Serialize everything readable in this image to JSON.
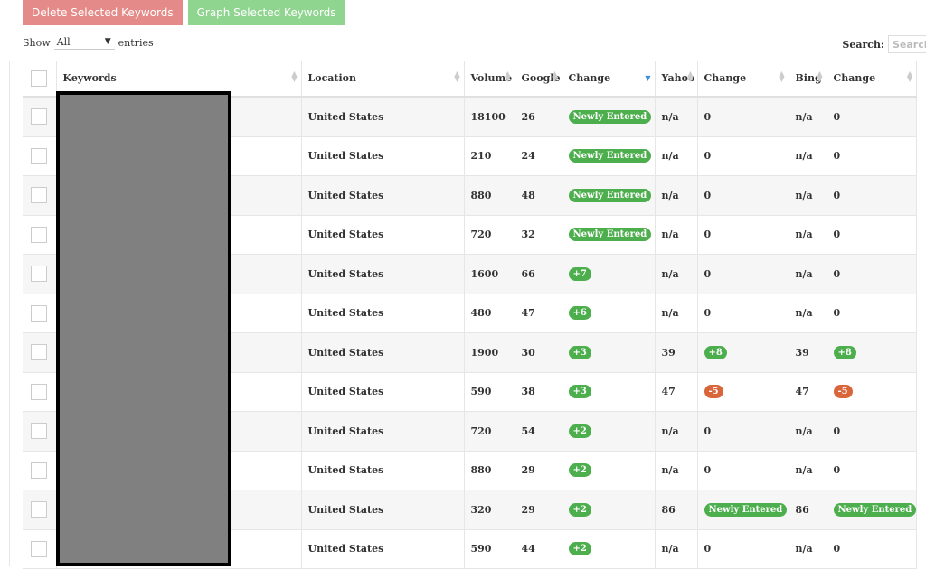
{
  "toolbar": {
    "delete_label": "Delete Selected Keywords",
    "graph_label": "Graph Selected Keywords"
  },
  "controls": {
    "show_label": "Show",
    "show_value": "All",
    "entries_label": "entries",
    "search_label": "Search:",
    "search_placeholder": "Search"
  },
  "columns": [
    "",
    "Keywords",
    "Location",
    "Volume",
    "Google",
    "Change",
    "Yahoo",
    "Change",
    "Bing",
    "Change"
  ],
  "colors": {
    "positive": "#4cae4c",
    "negative": "#d9653b",
    "delete": "#e48a88",
    "graph": "#8fd48f"
  },
  "rows": [
    {
      "location": "United States",
      "volume": "18100",
      "google": "26",
      "gchange": "Newly Entered",
      "yahoo": "n/a",
      "ychange": "0",
      "bing": "n/a",
      "bchange": "0"
    },
    {
      "location": "United States",
      "volume": "210",
      "google": "24",
      "gchange": "Newly Entered",
      "yahoo": "n/a",
      "ychange": "0",
      "bing": "n/a",
      "bchange": "0"
    },
    {
      "location": "United States",
      "volume": "880",
      "google": "48",
      "gchange": "Newly Entered",
      "yahoo": "n/a",
      "ychange": "0",
      "bing": "n/a",
      "bchange": "0"
    },
    {
      "location": "United States",
      "volume": "720",
      "google": "32",
      "gchange": "Newly Entered",
      "yahoo": "n/a",
      "ychange": "0",
      "bing": "n/a",
      "bchange": "0"
    },
    {
      "location": "United States",
      "volume": "1600",
      "google": "66",
      "gchange": "+7",
      "yahoo": "n/a",
      "ychange": "0",
      "bing": "n/a",
      "bchange": "0"
    },
    {
      "location": "United States",
      "volume": "480",
      "google": "47",
      "gchange": "+6",
      "yahoo": "n/a",
      "ychange": "0",
      "bing": "n/a",
      "bchange": "0"
    },
    {
      "location": "United States",
      "volume": "1900",
      "google": "30",
      "gchange": "+3",
      "yahoo": "39",
      "ychange": "+8",
      "bing": "39",
      "bchange": "+8"
    },
    {
      "location": "United States",
      "volume": "590",
      "google": "38",
      "gchange": "+3",
      "yahoo": "47",
      "ychange": "-5",
      "bing": "47",
      "bchange": "-5"
    },
    {
      "location": "United States",
      "volume": "720",
      "google": "54",
      "gchange": "+2",
      "yahoo": "n/a",
      "ychange": "0",
      "bing": "n/a",
      "bchange": "0"
    },
    {
      "location": "United States",
      "volume": "880",
      "google": "29",
      "gchange": "+2",
      "yahoo": "n/a",
      "ychange": "0",
      "bing": "n/a",
      "bchange": "0"
    },
    {
      "location": "United States",
      "volume": "320",
      "google": "29",
      "gchange": "+2",
      "yahoo": "86",
      "ychange": "Newly Entered",
      "bing": "86",
      "bchange": "Newly Entered"
    },
    {
      "location": "United States",
      "volume": "590",
      "google": "44",
      "gchange": "+2",
      "yahoo": "n/a",
      "ychange": "0",
      "bing": "n/a",
      "bchange": "0"
    }
  ]
}
